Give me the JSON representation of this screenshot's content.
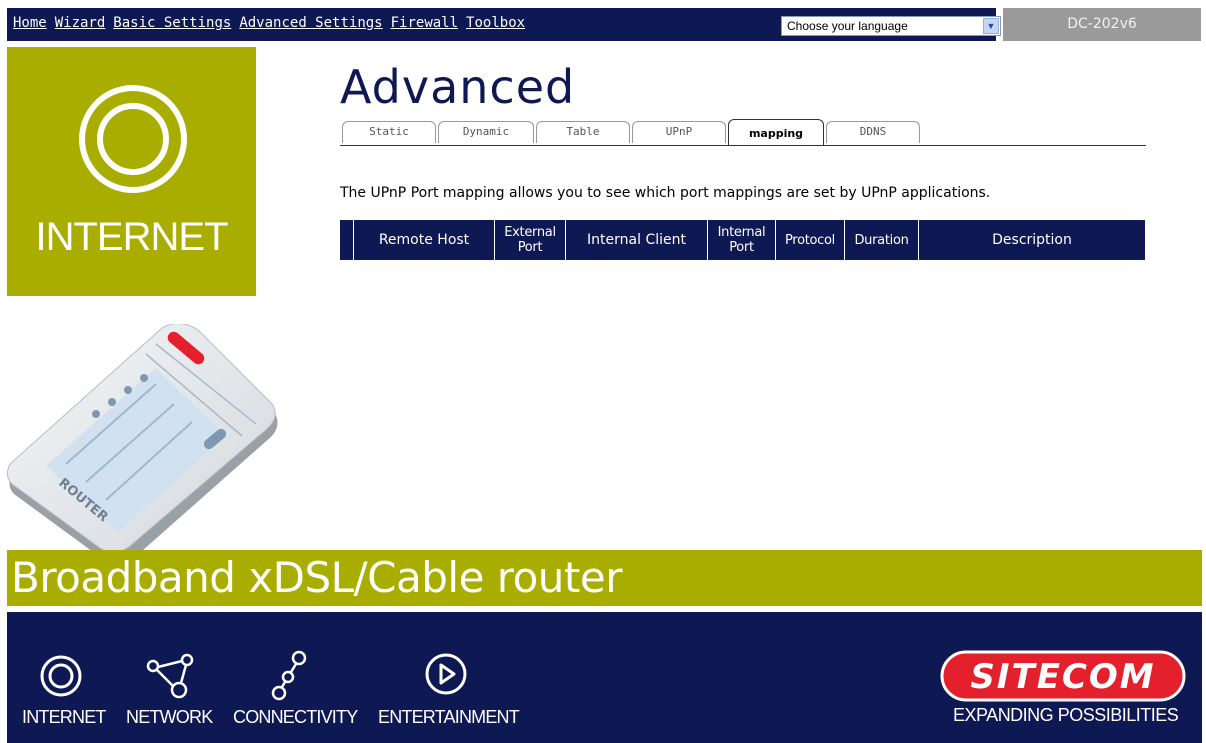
{
  "nav": {
    "items": [
      "Home",
      "Wizard",
      "Basic Settings",
      "Advanced Settings",
      "Firewall",
      "Toolbox"
    ],
    "language_select": "Choose your language",
    "model": "DC-202v6"
  },
  "sidebar": {
    "label": "INTERNET"
  },
  "router_label": "ROUTER",
  "main": {
    "heading": "Advanced",
    "tabs": [
      "Static",
      "Dynamic",
      "Table",
      "UPnP",
      "mapping",
      "DDNS"
    ],
    "active_tab": "mapping",
    "description": "The UPnP Port mapping allows you to see which port mappings are set by UPnP applications.",
    "table": {
      "columns": [
        {
          "line1": "Remote Host",
          "line2": ""
        },
        {
          "line1": "External",
          "line2": "Port"
        },
        {
          "line1": "Internal Client",
          "line2": ""
        },
        {
          "line1": "Internal",
          "line2": "Port"
        },
        {
          "line1": "Protocol",
          "line2": ""
        },
        {
          "line1": "Duration",
          "line2": ""
        },
        {
          "line1": "Description",
          "line2": ""
        }
      ],
      "rows": []
    }
  },
  "banner": {
    "title": "Broadband xDSL/Cable router"
  },
  "footer": {
    "items": [
      {
        "label": "INTERNET",
        "icon": "internet-icon"
      },
      {
        "label": "NETWORK",
        "icon": "network-icon"
      },
      {
        "label": "CONNECTIVITY",
        "icon": "connectivity-icon"
      },
      {
        "label": "ENTERTAINMENT",
        "icon": "entertainment-icon"
      }
    ],
    "brand": "SITECOM",
    "tagline": "EXPANDING POSSIBILITIES"
  },
  "colors": {
    "navy": "#0e1852",
    "olive": "#a8ad00",
    "model_bg": "#9a9a9a",
    "brand_red": "#e3202b"
  }
}
